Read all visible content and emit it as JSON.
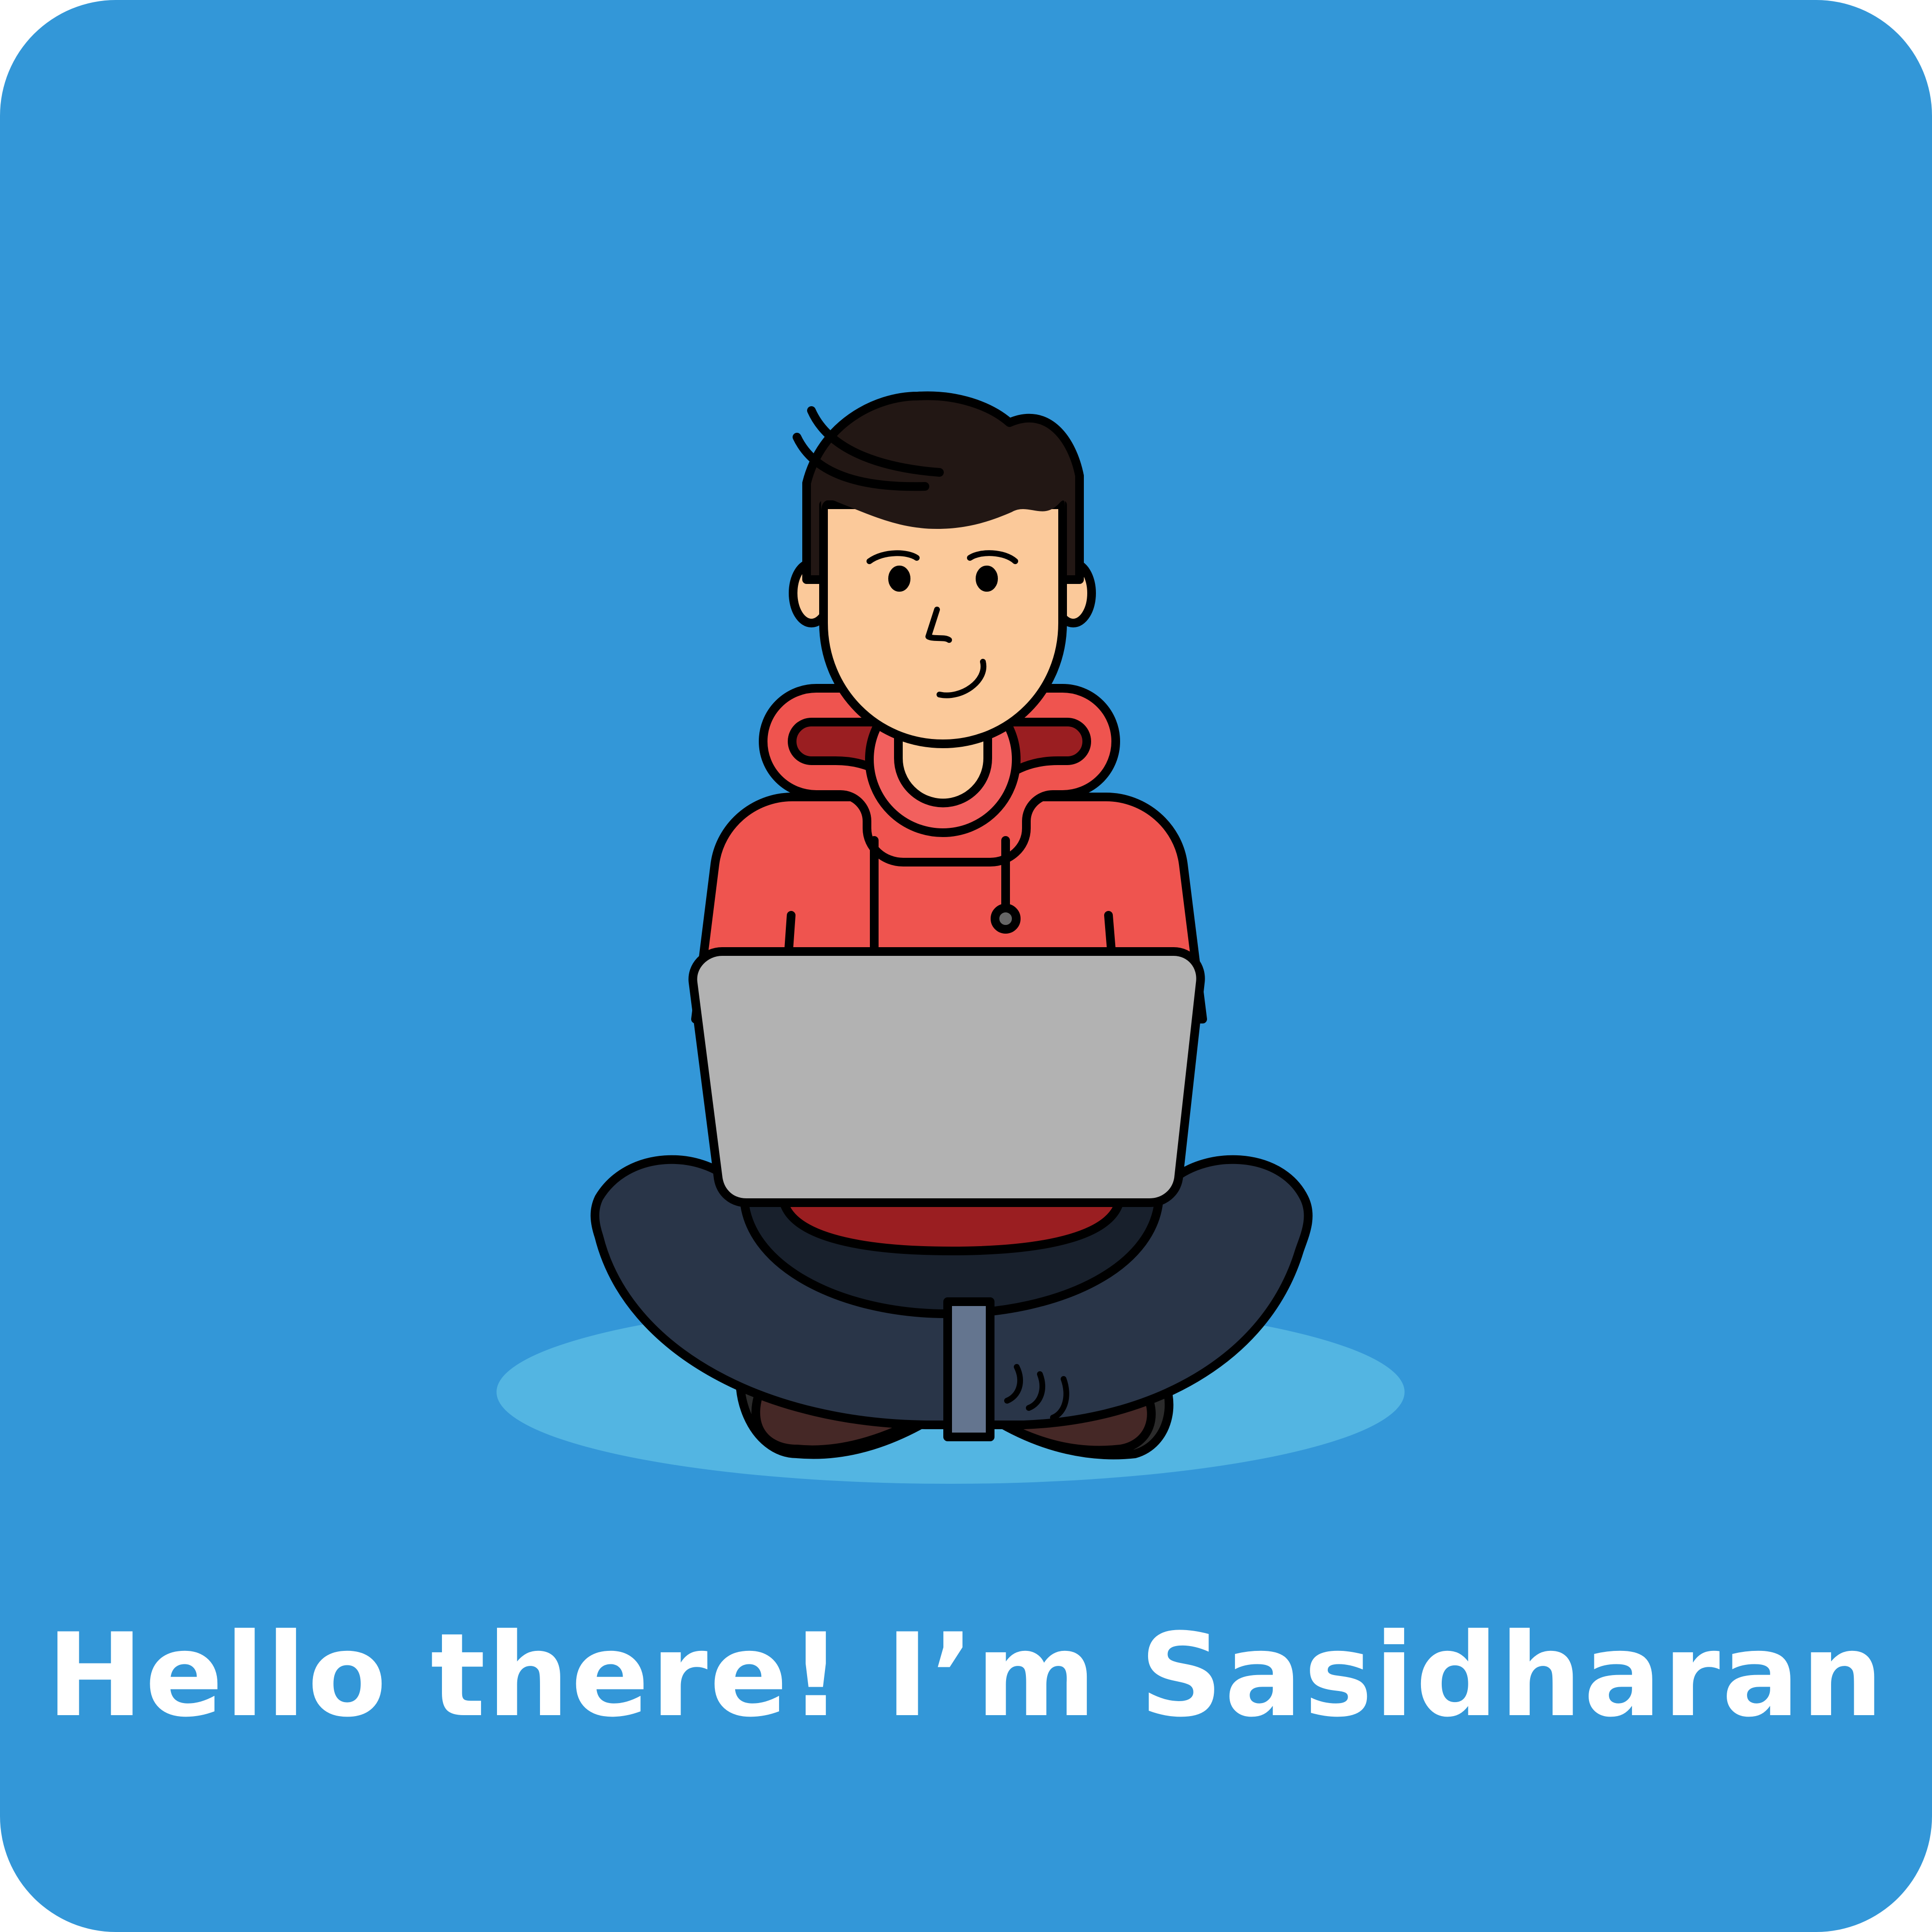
{
  "card": {
    "background_color": "#3397D8",
    "greeting": "Hello there! I’m Sasidharan"
  },
  "illustration": {
    "subject": "person-sitting-cross-legged-with-laptop",
    "colors": {
      "shadow": "#53B5E2",
      "skin": "#FBC99A",
      "skin_shade": "#E4A775",
      "hair": "#221714",
      "hoodie": "#EF544F",
      "hoodie_dark": "#9A1E21",
      "pants": "#293548",
      "pants_dark": "#18202C",
      "shoes": "#452826",
      "laptop": "#B2B2B2",
      "stand": "#64758F",
      "outline": "#000000"
    }
  }
}
